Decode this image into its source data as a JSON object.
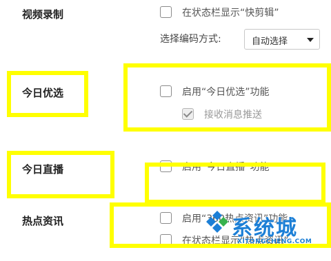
{
  "sections": [
    {
      "label": "视频录制",
      "options": [
        {
          "text": "在状态栏显示“快剪辑”",
          "checked": false
        }
      ],
      "encoding": {
        "label": "选择编码方式:",
        "selected": "自动选择"
      }
    },
    {
      "label": "今日优选",
      "options": [
        {
          "text": "启用“今日优选”功能",
          "checked": false
        },
        {
          "text": "接收消息推送",
          "checked": true
        }
      ]
    },
    {
      "label": "今日直播",
      "options": [
        {
          "text": "启用“今日直播”功能",
          "checked": false
        }
      ]
    },
    {
      "label": "热点资讯",
      "options": [
        {
          "text": "启用“360热点资讯”功能",
          "checked": false
        },
        {
          "text": "在状态栏显示“热点资讯”",
          "checked": false
        }
      ]
    }
  ],
  "watermark": {
    "text": "系统城",
    "url_text": "XITONGCHENG.COM",
    "color": "#1c7fd6"
  },
  "highlight_color": "#ffff00"
}
